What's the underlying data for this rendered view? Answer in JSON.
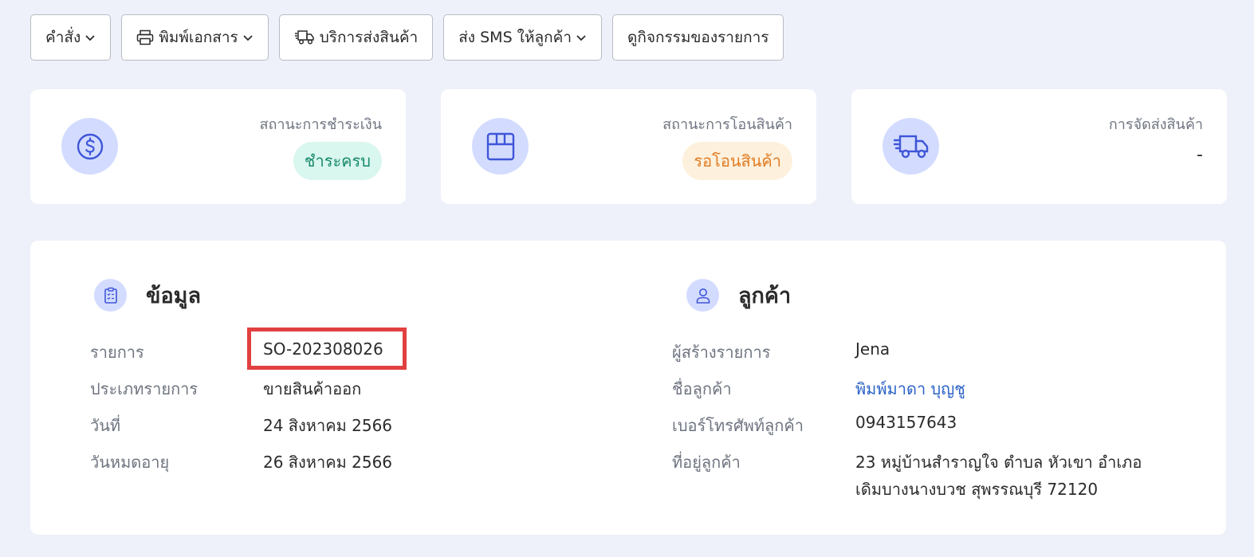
{
  "toolbar": {
    "command_label": "คำสั่ง",
    "print_label": "พิมพ์เอกสาร",
    "shipping_label": "บริการส่งสินค้า",
    "sms_label": "ส่ง SMS ให้ลูกค้า",
    "activity_label": "ดูกิจกรรมของรายการ"
  },
  "status_cards": {
    "payment": {
      "label": "สถานะการชำระเงิน",
      "value": "ชำระครบ",
      "icon": "dollar-circle-icon",
      "color": "#178a6a"
    },
    "transfer": {
      "label": "สถานะการโอนสินค้า",
      "value": "รอโอนสินค้า",
      "icon": "box-icon",
      "color": "#e07b23"
    },
    "delivery": {
      "label": "การจัดส่งสินค้า",
      "value": "-",
      "icon": "truck-icon"
    }
  },
  "info": {
    "title": "ข้อมูล",
    "icon": "clipboard-icon",
    "rows": [
      {
        "label": "รายการ",
        "value": "SO-202308026"
      },
      {
        "label": "ประเภทรายการ",
        "value": "ขายสินค้าออก"
      },
      {
        "label": "วันที่",
        "value": "24 สิงหาคม 2566"
      },
      {
        "label": "วันหมดอายุ",
        "value": "26 สิงหาคม 2566"
      }
    ]
  },
  "customer": {
    "title": "ลูกค้า",
    "icon": "user-icon",
    "rows": [
      {
        "label": "ผู้สร้างรายการ",
        "value": "Jena"
      },
      {
        "label": "ชื่อลูกค้า",
        "value": "พิมพ์มาดา บุญชู"
      },
      {
        "label": "เบอร์โทรศัพท์ลูกค้า",
        "value": "0943157643"
      },
      {
        "label": "ที่อยู่ลูกค้า",
        "value_line1": "23 หมู่บ้านสำราญใจ ตำบล หัวเขา อำเภอ",
        "value_line2": "เดิมบางนางบวช สุพรรณบุรี 72120"
      }
    ]
  },
  "colors": {
    "background": "#eef1f9",
    "accent": "#3f56d8",
    "highlight": "#e14040",
    "link": "#2a62c7"
  }
}
